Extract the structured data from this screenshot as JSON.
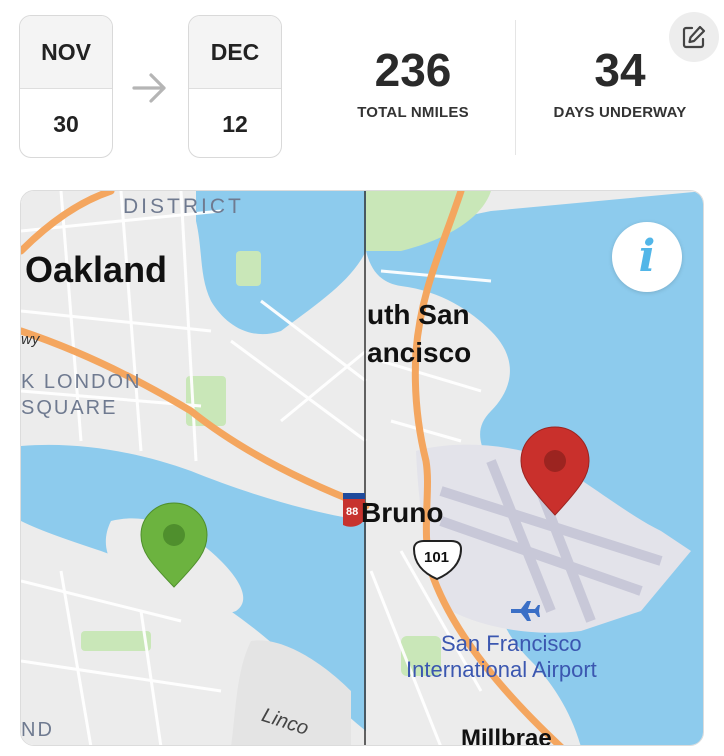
{
  "trip": {
    "start": {
      "month": "NOV",
      "day": "30"
    },
    "end": {
      "month": "DEC",
      "day": "12"
    }
  },
  "stats": {
    "distance": {
      "value": "236",
      "label": "TOTAL NMILES"
    },
    "days": {
      "value": "34",
      "label": "DAYS UNDERWAY"
    }
  },
  "map": {
    "labels": {
      "district": "DISTRICT",
      "oakland": "Oakland",
      "jack_london_1": "K LONDON",
      "jack_london_2": "SQUARE",
      "south_sf_1": "uth San",
      "south_sf_2": "ancisco",
      "san_bruno": "Bruno",
      "highway_101": "101",
      "interstate_880": "88",
      "sfo_1": "San Francisco",
      "sfo_2": "International Airport",
      "street_partial": "wy",
      "lincoln": "Linco",
      "millbrae": "Millbrae",
      "bottom_left": "ND"
    },
    "markers": {
      "start": {
        "color": "#6cb33f",
        "role": "start"
      },
      "end": {
        "color": "#c9302c",
        "role": "end"
      }
    },
    "colors": {
      "water": "#8dcbed",
      "land": "#ececec",
      "park": "#c9e7b8",
      "highway": "#f4a65f"
    }
  },
  "icons": {
    "edit": "edit-icon",
    "arrow": "arrow-right-icon",
    "info": "info-icon"
  }
}
